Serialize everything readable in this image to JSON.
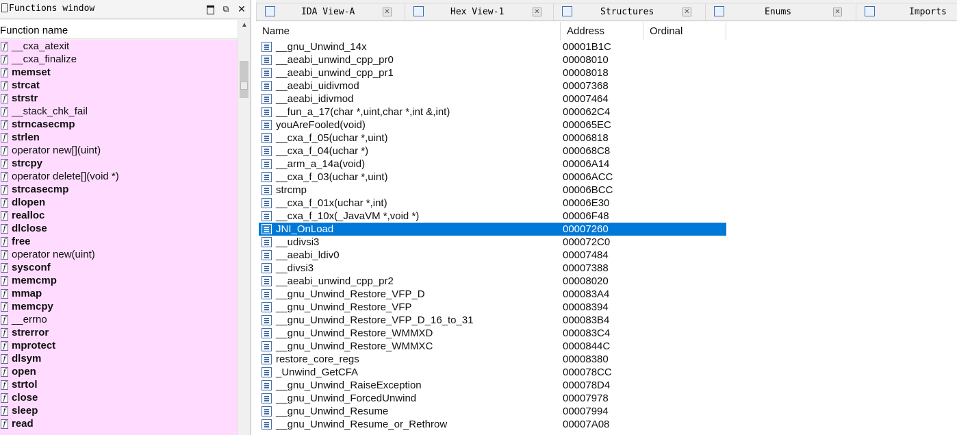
{
  "functions_window": {
    "title": "Functions window",
    "column_header": "Function name",
    "items": [
      {
        "name": "__cxa_atexit",
        "bold": false
      },
      {
        "name": "__cxa_finalize",
        "bold": false
      },
      {
        "name": "memset",
        "bold": true
      },
      {
        "name": "strcat",
        "bold": true
      },
      {
        "name": "strstr",
        "bold": true
      },
      {
        "name": "__stack_chk_fail",
        "bold": false
      },
      {
        "name": "strncasecmp",
        "bold": true
      },
      {
        "name": "strlen",
        "bold": true
      },
      {
        "name": "operator new[](uint)",
        "bold": false
      },
      {
        "name": "strcpy",
        "bold": true
      },
      {
        "name": "operator delete[](void *)",
        "bold": false
      },
      {
        "name": "strcasecmp",
        "bold": true
      },
      {
        "name": "dlopen",
        "bold": true
      },
      {
        "name": "realloc",
        "bold": true
      },
      {
        "name": "dlclose",
        "bold": true
      },
      {
        "name": "free",
        "bold": true
      },
      {
        "name": "operator new(uint)",
        "bold": false
      },
      {
        "name": "sysconf",
        "bold": true
      },
      {
        "name": "memcmp",
        "bold": true
      },
      {
        "name": "mmap",
        "bold": true
      },
      {
        "name": "memcpy",
        "bold": true
      },
      {
        "name": "__errno",
        "bold": false
      },
      {
        "name": "strerror",
        "bold": true
      },
      {
        "name": "mprotect",
        "bold": true
      },
      {
        "name": "dlsym",
        "bold": true
      },
      {
        "name": "open",
        "bold": true
      },
      {
        "name": "strtol",
        "bold": true
      },
      {
        "name": "close",
        "bold": true
      },
      {
        "name": "sleep",
        "bold": true
      },
      {
        "name": "read",
        "bold": true
      }
    ]
  },
  "tabs": [
    {
      "label": "IDA View-A",
      "icon": "ida-view-icon"
    },
    {
      "label": "Hex View-1",
      "icon": "hex-view-icon"
    },
    {
      "label": "Structures",
      "icon": "structures-icon"
    },
    {
      "label": "Enums",
      "icon": "enums-icon"
    },
    {
      "label": "Imports",
      "icon": "imports-icon"
    }
  ],
  "exports": {
    "columns": [
      "Name",
      "Address",
      "Ordinal"
    ],
    "selected_index": 14,
    "rows": [
      {
        "name": "__gnu_Unwind_14x",
        "address": "00001B1C"
      },
      {
        "name": "__aeabi_unwind_cpp_pr0",
        "address": "00008010"
      },
      {
        "name": "__aeabi_unwind_cpp_pr1",
        "address": "00008018"
      },
      {
        "name": "__aeabi_uidivmod",
        "address": "00007368"
      },
      {
        "name": "__aeabi_idivmod",
        "address": "00007464"
      },
      {
        "name": "__fun_a_17(char *,uint,char *,int &,int)",
        "address": "000062C4"
      },
      {
        "name": "youAreFooled(void)",
        "address": "000065EC"
      },
      {
        "name": "__cxa_f_05(uchar *,uint)",
        "address": "00006818"
      },
      {
        "name": "__cxa_f_04(uchar *)",
        "address": "000068C8"
      },
      {
        "name": "__arm_a_14a(void)",
        "address": "00006A14"
      },
      {
        "name": "__cxa_f_03(uchar *,uint)",
        "address": "00006ACC"
      },
      {
        "name": "strcmp",
        "address": "00006BCC"
      },
      {
        "name": "__cxa_f_01x(uchar *,int)",
        "address": "00006E30"
      },
      {
        "name": "__cxa_f_10x(_JavaVM *,void *)",
        "address": "00006F48"
      },
      {
        "name": "JNI_OnLoad",
        "address": "00007260"
      },
      {
        "name": "__udivsi3",
        "address": "000072C0"
      },
      {
        "name": "__aeabi_ldiv0",
        "address": "00007484"
      },
      {
        "name": "__divsi3",
        "address": "00007388"
      },
      {
        "name": "__aeabi_unwind_cpp_pr2",
        "address": "00008020"
      },
      {
        "name": "__gnu_Unwind_Restore_VFP_D",
        "address": "000083A4"
      },
      {
        "name": "__gnu_Unwind_Restore_VFP",
        "address": "00008394"
      },
      {
        "name": "__gnu_Unwind_Restore_VFP_D_16_to_31",
        "address": "000083B4"
      },
      {
        "name": "__gnu_Unwind_Restore_WMMXD",
        "address": "000083C4"
      },
      {
        "name": "__gnu_Unwind_Restore_WMMXC",
        "address": "0000844C"
      },
      {
        "name": "restore_core_regs",
        "address": "00008380"
      },
      {
        "name": "_Unwind_GetCFA",
        "address": "000078CC"
      },
      {
        "name": "__gnu_Unwind_RaiseException",
        "address": "000078D4"
      },
      {
        "name": "__gnu_Unwind_ForcedUnwind",
        "address": "00007978"
      },
      {
        "name": "__gnu_Unwind_Resume",
        "address": "00007994"
      },
      {
        "name": "__gnu_Unwind_Resume_or_Rethrow",
        "address": "00007A08"
      }
    ]
  },
  "colors": {
    "functions_bg": "#ffdcff",
    "selection": "#0078d7"
  }
}
